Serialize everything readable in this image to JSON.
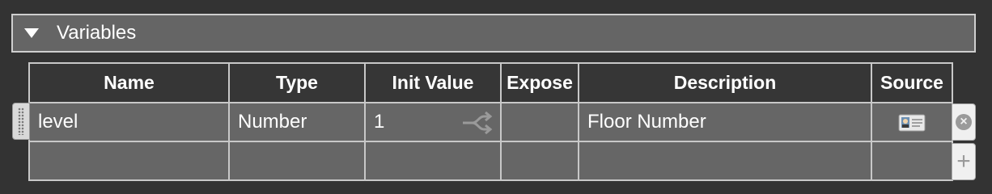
{
  "section": {
    "title": "Variables",
    "expanded": true
  },
  "table": {
    "columns": [
      "Name",
      "Type",
      "Init Value",
      "Expose",
      "Description",
      "Source"
    ],
    "rows": [
      {
        "name": "level",
        "type": "Number",
        "init_value": "1",
        "expose": "",
        "description": "Floor Number",
        "source_icon": "id-card-icon"
      }
    ]
  },
  "icons": {
    "disclosure": "triangle-down-icon",
    "init_value_action": "shuffle-icon",
    "remove": "remove-circle-icon",
    "add": "plus-icon",
    "drag": "drag-handle-icon"
  },
  "controls": {
    "remove_glyph": "×",
    "add_glyph": "+"
  },
  "colors": {
    "background": "#333333",
    "header_bar": "#656565",
    "cell": "#666666",
    "header_cell": "#363636",
    "border": "#c8c8c8"
  }
}
